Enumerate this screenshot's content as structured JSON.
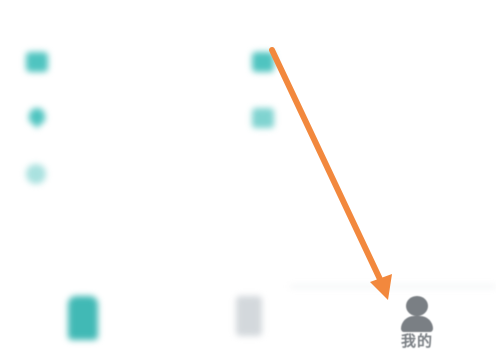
{
  "section": {
    "title": ""
  },
  "grid_items": [
    {
      "icon": "square-icon",
      "label": ""
    },
    {
      "icon": "square-icon",
      "label": ""
    },
    {
      "icon": "heart-icon",
      "label": ""
    },
    {
      "icon": "house-icon",
      "label": ""
    },
    {
      "icon": "circle-icon",
      "label": ""
    }
  ],
  "bottom_nav": {
    "home": {
      "icon": "home-icon",
      "label": ""
    },
    "docs": {
      "icon": "document-icon",
      "label": ""
    },
    "mine": {
      "icon": "user-icon",
      "label": "我的"
    }
  },
  "annotation": {
    "type": "arrow",
    "color": "#f2883d",
    "target": "tab-mine"
  },
  "colors": {
    "accent": "#41b9b5",
    "inactive_tab": "#7a7f84",
    "arrow": "#f2883d"
  }
}
